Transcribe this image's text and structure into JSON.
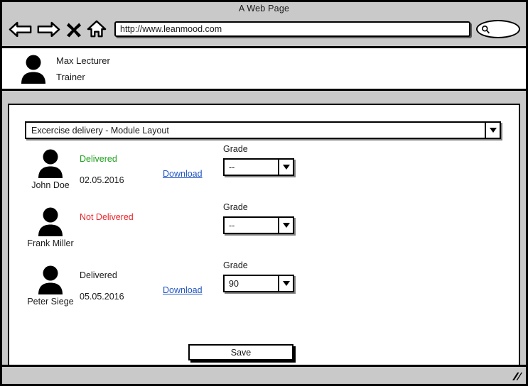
{
  "window": {
    "title": "A Web Page",
    "url": "http://www.leanmood.com",
    "icons": {
      "back": "back-arrow-icon",
      "forward": "forward-arrow-icon",
      "stop": "close-x-icon",
      "home": "home-icon",
      "search": "search-icon",
      "resize": "resize-grip-icon"
    }
  },
  "profile": {
    "avatar": "user-avatar-icon",
    "name": "Max Lecturer",
    "role": "Trainer"
  },
  "module_select": {
    "value": "Excercise delivery - Module Layout",
    "caret": "chevron-down-icon"
  },
  "grade_label": "Grade",
  "download_label": "Download",
  "colors": {
    "delivered_green": "#20a020",
    "not_delivered_red": "#e8272b",
    "link_blue": "#2356c0",
    "chrome_gray": "#c9c9c9"
  },
  "students": [
    {
      "name": "John Doe",
      "avatar": "user-avatar-icon",
      "status": "Delivered",
      "status_color": "#20a020",
      "date": "02.05.2016",
      "has_download": true,
      "grade": "--"
    },
    {
      "name": "Frank Miller",
      "avatar": "user-avatar-icon",
      "status": "Not Delivered",
      "status_color": "#e8272b",
      "date": "",
      "has_download": false,
      "grade": "--"
    },
    {
      "name": "Peter Siege",
      "avatar": "user-avatar-icon",
      "status": "Delivered",
      "status_color": "#1a1a1a",
      "date": "05.05.2016",
      "has_download": true,
      "grade": "90"
    }
  ],
  "save": {
    "label": "Save"
  }
}
